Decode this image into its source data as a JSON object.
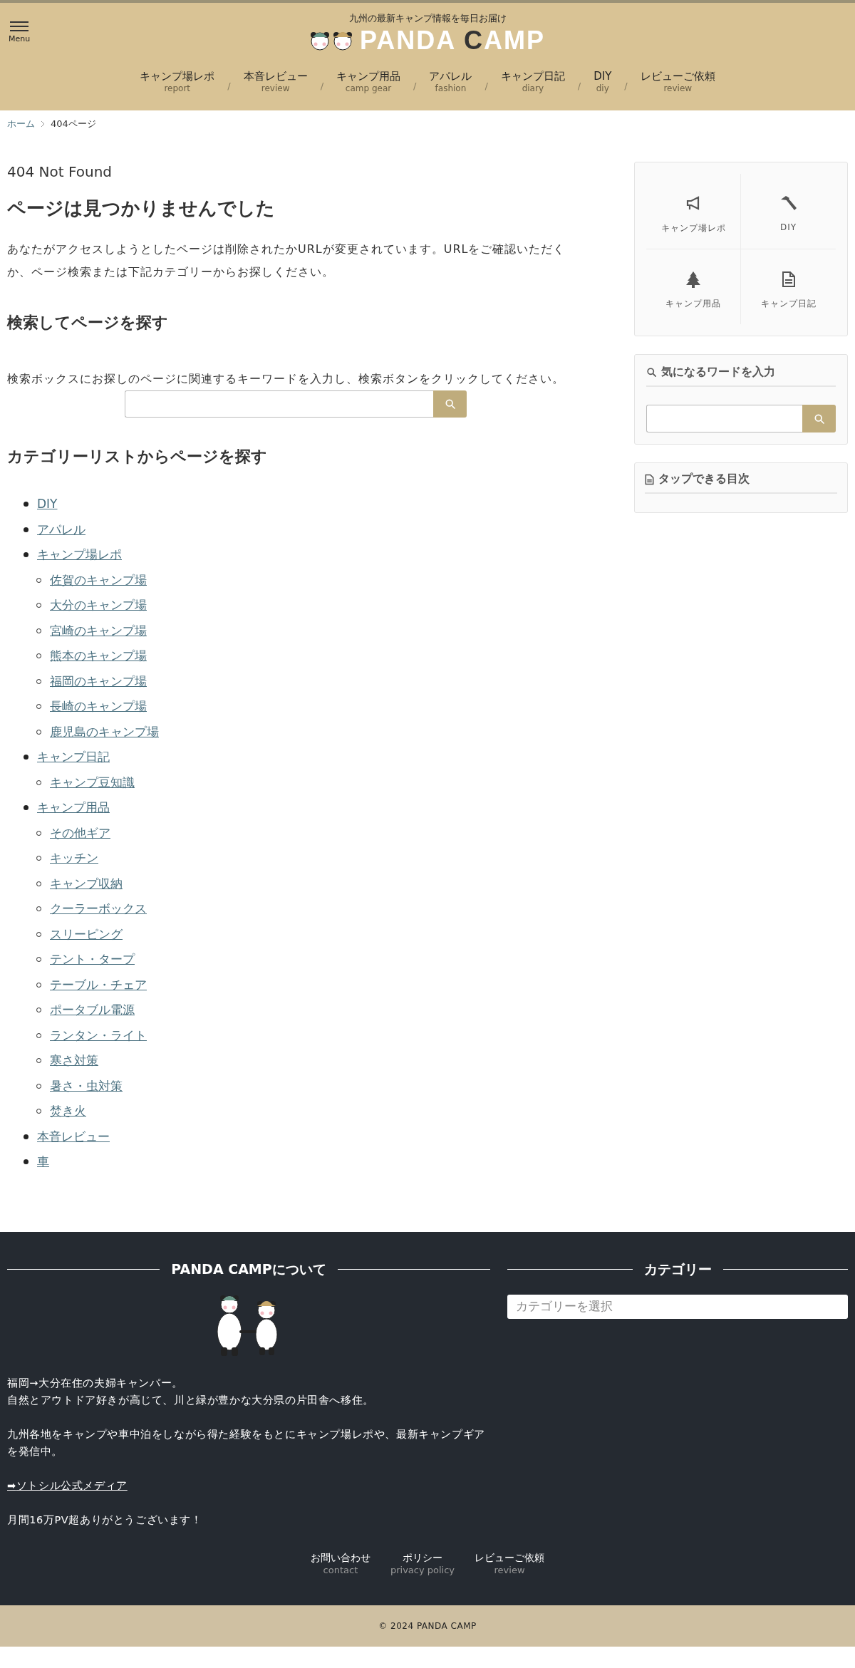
{
  "header": {
    "menu_label": "Menu",
    "tagline": "九州の最新キャンプ情報を毎日お届け",
    "logo": [
      {
        "text": "PANDA ",
        "accent": false
      },
      {
        "text": "C",
        "accent": true
      },
      {
        "text": "AMP",
        "accent": false
      }
    ],
    "nav": [
      {
        "label": "キャンプ場レポ",
        "sub": "report"
      },
      {
        "separator": "/",
        "label": "本音レビュー",
        "sub": "review"
      },
      {
        "separator": "/",
        "label": "キャンプ用品",
        "sub": "camp gear"
      },
      {
        "separator": "/",
        "label": "アパレル",
        "sub": "fashion"
      },
      {
        "separator": "/",
        "label": "キャンプ日記",
        "sub": "diary"
      },
      {
        "separator": "/",
        "label": "DIY",
        "sub": "diy"
      },
      {
        "separator": "/",
        "label": "レビューご依頼",
        "sub": "review"
      }
    ]
  },
  "breadcrumb": [
    {
      "label": "ホーム",
      "link": true
    },
    {
      "label": "404ページ",
      "link": false
    }
  ],
  "main": {
    "eyebrow": "404 Not Found",
    "title": "ページは見つかりませんでした",
    "intro": "あなたがアクセスしようとしたページは削除されたかURLが変更されています。URLをご確認いただくか、ページ検索または下記カテゴリーからお探しください。",
    "search_heading": "検索してページを探す",
    "search_text": "検索ボックスにお探しのページに関連するキーワードを入力し、検索ボタンをクリックしてください。",
    "category_heading": "カテゴリーリストからページを探す",
    "categories": [
      {
        "label": "DIY"
      },
      {
        "label": "アパレル"
      },
      {
        "label": "キャンプ場レポ",
        "children": [
          {
            "label": "佐賀のキャンプ場"
          },
          {
            "label": "大分のキャンプ場"
          },
          {
            "label": "宮崎のキャンプ場"
          },
          {
            "label": "熊本のキャンプ場"
          },
          {
            "label": "福岡のキャンプ場"
          },
          {
            "label": "長崎のキャンプ場"
          },
          {
            "label": "鹿児島のキャンプ場"
          }
        ]
      },
      {
        "label": "キャンプ日記",
        "children": [
          {
            "label": "キャンプ豆知識"
          }
        ]
      },
      {
        "label": "キャンプ用品",
        "children": [
          {
            "label": "その他ギア"
          },
          {
            "label": "キッチン"
          },
          {
            "label": "キャンプ収納"
          },
          {
            "label": "クーラーボックス"
          },
          {
            "label": "スリーピング"
          },
          {
            "label": "テント・タープ"
          },
          {
            "label": "テーブル・チェア"
          },
          {
            "label": "ポータブル電源"
          },
          {
            "label": "ランタン・ライト"
          },
          {
            "label": "寒さ対策"
          },
          {
            "label": "暑さ・虫対策"
          },
          {
            "label": "焚き火"
          }
        ]
      },
      {
        "label": "本音レビュー"
      },
      {
        "label": "車"
      }
    ]
  },
  "sidebar": {
    "tiles": [
      {
        "label": "キャンプ場レポ"
      },
      {
        "label": "DIY"
      },
      {
        "label": "キャンプ用品"
      },
      {
        "label": "キャンプ日記"
      }
    ],
    "search_title": "気になるワードを入力",
    "toc_title": "タップできる目次"
  },
  "footer": {
    "about_title": "PANDA CAMPについて",
    "category_title": "カテゴリー",
    "category_placeholder": "カテゴリーを選択",
    "paragraphs": [
      {
        "kind": "text",
        "lines": [
          "福岡→大分在住の夫婦キャンパー。",
          "自然とアウトドア好きが高じて、川と緑が豊かな大分県の片田舎へ移住。"
        ]
      },
      {
        "kind": "text",
        "lines": [
          "九州各地をキャンプや車中泊をしながら得た経験をもとにキャンプ場レポや、最新キャンプギアを発信中。"
        ]
      },
      {
        "kind": "link",
        "prefix": "➡",
        "lines": [
          "ソトシル公式メディア"
        ]
      },
      {
        "kind": "text",
        "lines": [
          "月間16万PV超ありがとうございます！"
        ]
      }
    ],
    "links": [
      {
        "label": "お問い合わせ",
        "sub": "contact"
      },
      {
        "label": "ポリシー",
        "sub": "privacy policy"
      },
      {
        "label": "レビューご依頼",
        "sub": "review"
      }
    ],
    "copyright": "© 2024 PANDA CAMP"
  }
}
